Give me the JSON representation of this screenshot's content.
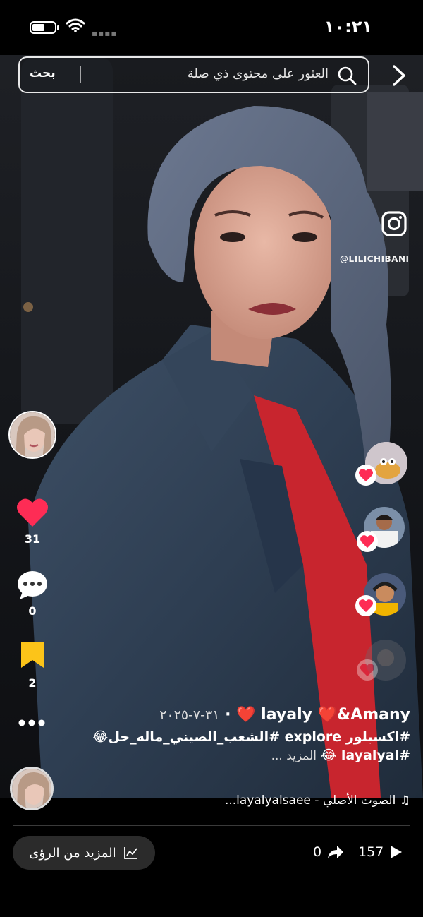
{
  "status_bar": {
    "time": "١٠:٢١",
    "battery_level": 0.55
  },
  "search": {
    "placeholder": "العثور على محتوى ذي صلة",
    "button_label": "بحث"
  },
  "watermark": {
    "handle": "@LILICHIBANI"
  },
  "actions": {
    "likes": "31",
    "comments": "0",
    "saves": "2"
  },
  "caption": {
    "author": "layaly ❤️&Amany ❤️",
    "date": "٣١-٧-٢٠٢٥",
    "separator": "·",
    "hashtags_line": "#اكسبلور explore #الشعب_الصيني_ماله_حل😂",
    "hashtags_line2": "#layalyal 😂",
    "more_label": "المزيد ..."
  },
  "music": {
    "label": "الصوت الأصلي - layalyalsaee..."
  },
  "playback": {
    "progress": 0.0
  },
  "bottom": {
    "insights_label": "المزيد من الرؤى",
    "views": "157",
    "shares": "0"
  },
  "colors": {
    "like_red": "#fe2c55",
    "save_yellow": "#fcc419",
    "background": "#000000"
  },
  "icons": {
    "back": "chevron-right-icon",
    "search": "magnifier-icon",
    "instagram": "instagram-icon",
    "like": "heart-icon",
    "comment": "speech-bubble-icon",
    "save": "bookmark-icon",
    "more": "ellipsis-icon",
    "music": "music-note-icon",
    "insights": "line-chart-icon",
    "share": "share-arrow-icon",
    "views": "play-icon"
  }
}
